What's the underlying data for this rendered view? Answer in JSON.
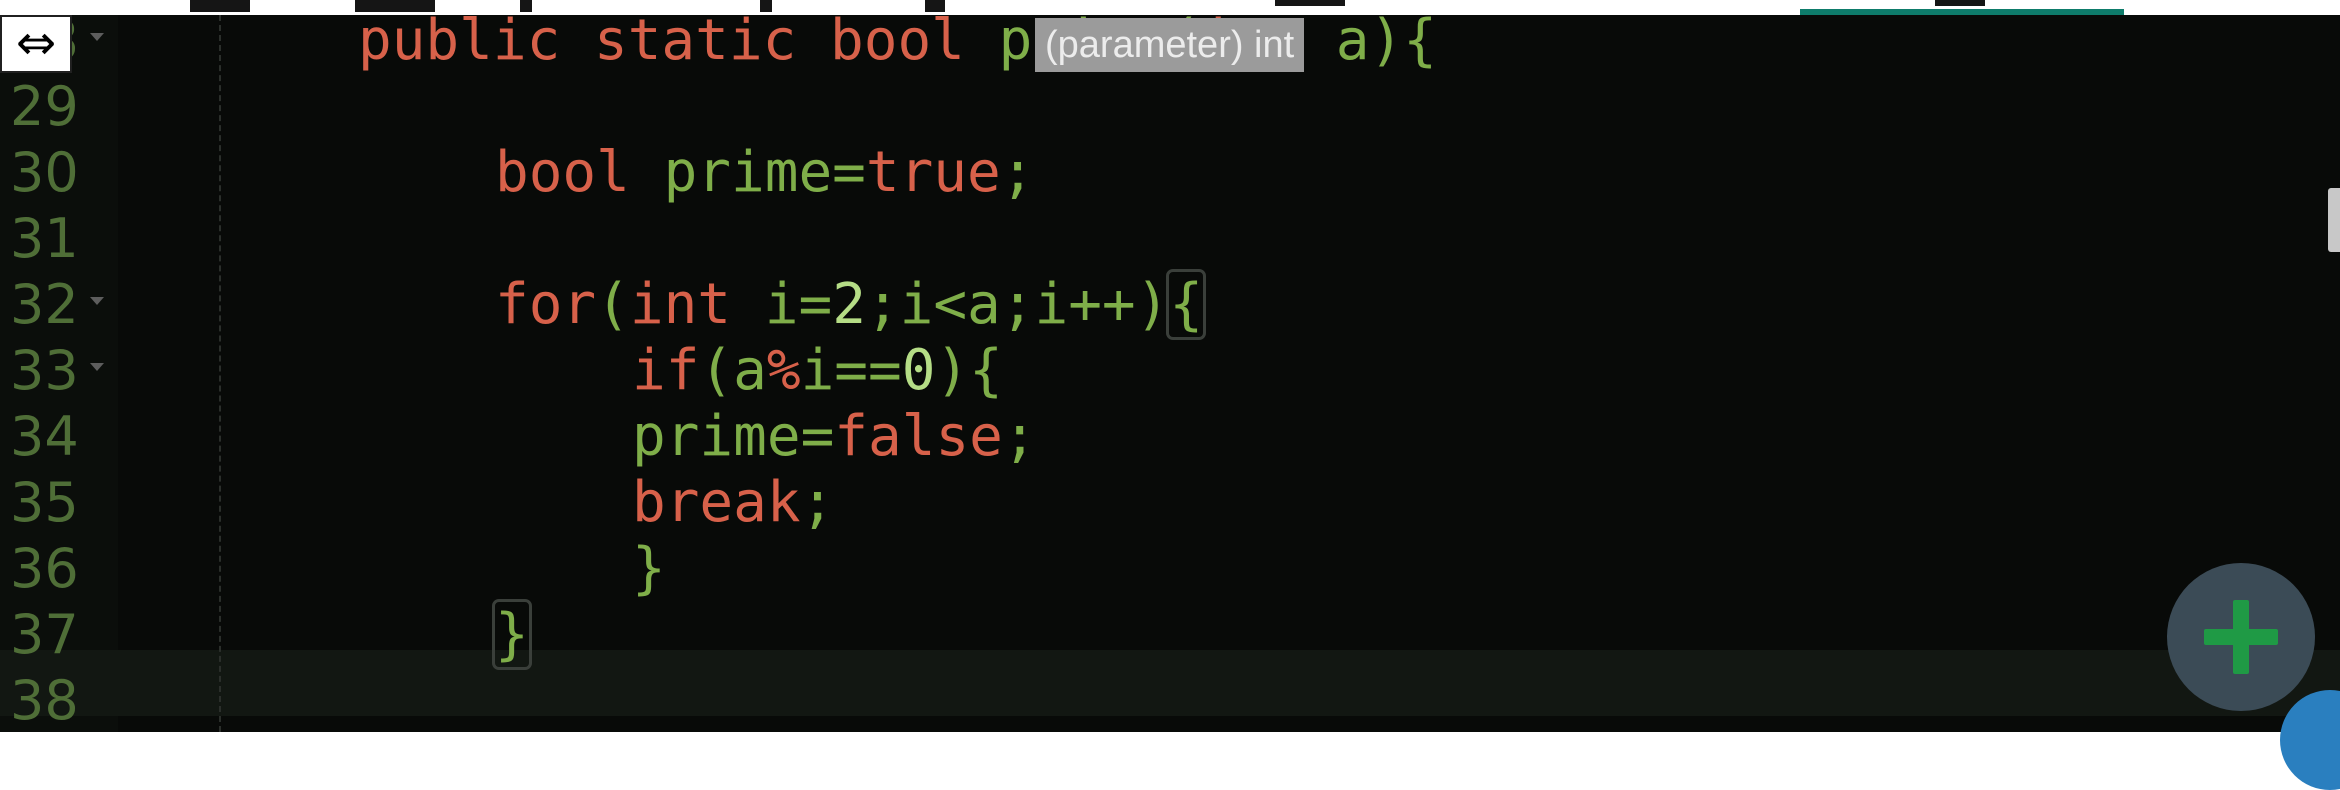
{
  "tooltip": {
    "text": "(parameter) int"
  },
  "icons": {
    "resize": "resize-horizontal-icon",
    "add": "plus-icon"
  },
  "colors": {
    "keyword": "#d7614a",
    "identifier": "#7fae49",
    "number": "#b5dd86",
    "line_number": "#4f6e37",
    "background": "#080a08"
  },
  "editor": {
    "lines": [
      {
        "num": "28",
        "tokens": [
          [
            "kw",
            "public static bool "
          ],
          [
            "id",
            "prime("
          ],
          [
            "kw",
            "int"
          ],
          [
            "id",
            " a){"
          ]
        ]
      },
      {
        "num": "29",
        "tokens": []
      },
      {
        "num": "30",
        "tokens": [
          [
            "kw",
            "bool "
          ],
          [
            "id",
            "prime="
          ],
          [
            "kw",
            "true"
          ],
          [
            "id",
            ";"
          ]
        ]
      },
      {
        "num": "31",
        "tokens": []
      },
      {
        "num": "32",
        "tokens": [
          [
            "kw",
            "for"
          ],
          [
            "id",
            "("
          ],
          [
            "kw",
            "int"
          ],
          [
            "id",
            " i="
          ],
          [
            "num",
            "2"
          ],
          [
            "id",
            ";i<a;i++)"
          ],
          [
            "brace",
            "{"
          ]
        ]
      },
      {
        "num": "33",
        "tokens": [
          [
            "kw",
            "if"
          ],
          [
            "id",
            "(a"
          ],
          [
            "kw",
            "%"
          ],
          [
            "id",
            "i=="
          ],
          [
            "num",
            "0"
          ],
          [
            "id",
            "){"
          ]
        ]
      },
      {
        "num": "34",
        "tokens": [
          [
            "id",
            "prime="
          ],
          [
            "kw",
            "false"
          ],
          [
            "id",
            ";"
          ]
        ]
      },
      {
        "num": "35",
        "tokens": [
          [
            "kw",
            "break"
          ],
          [
            "id",
            ";"
          ]
        ]
      },
      {
        "num": "36",
        "tokens": [
          [
            "id",
            "}"
          ]
        ]
      },
      {
        "num": "37",
        "tokens": [
          [
            "brace",
            "}"
          ]
        ]
      },
      {
        "num": "38",
        "tokens": []
      }
    ]
  }
}
